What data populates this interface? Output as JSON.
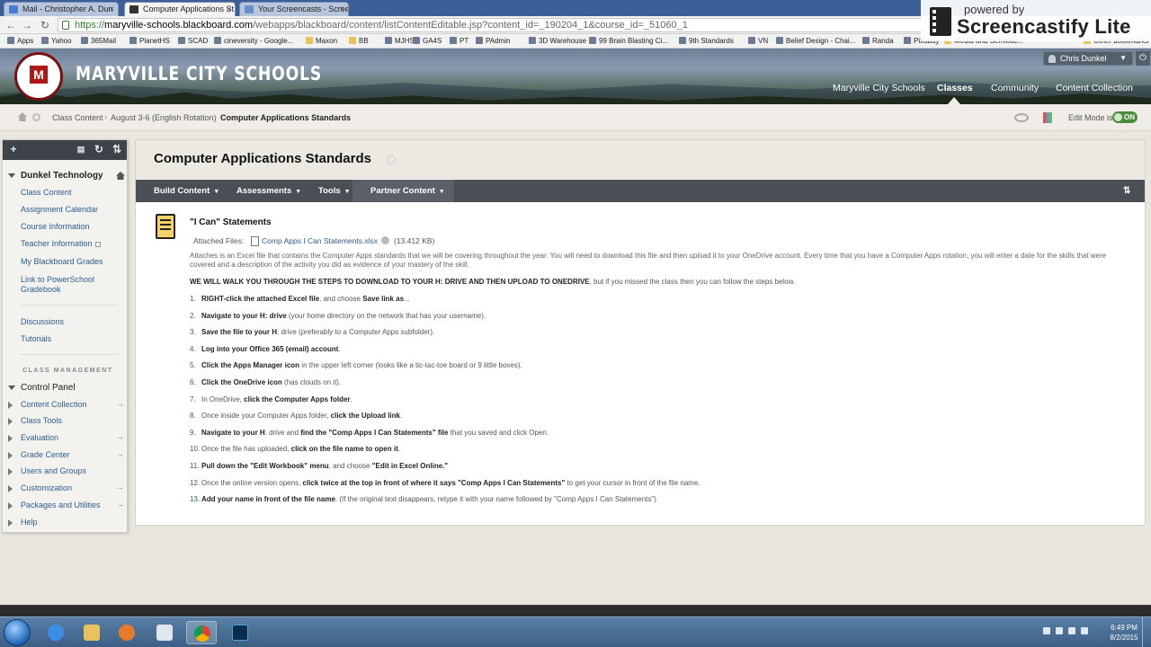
{
  "browser": {
    "tabs": [
      {
        "label": "Mail - Christopher A. Dun",
        "active": false
      },
      {
        "label": "Computer Applications St",
        "active": true
      },
      {
        "label": "Your Screencasts - Scree",
        "active": false
      }
    ],
    "url_scheme": "https://",
    "url_host": "maryville-schools.blackboard.com",
    "url_path": "/webapps/blackboard/content/listContentEditable.jsp?content_id=_190204_1&course_id=_51060_1",
    "bookmarks": [
      "Apps",
      "Yahoo",
      "365Mail",
      "PlanetHS",
      "SCAD",
      "cineversity - Google...",
      "Maxon",
      "BB",
      "MJHS",
      "GA4S",
      "PT",
      "PAdmin",
      "3D Warehouse",
      "99 Brain Blasting Ci...",
      "9th Standards",
      "VN",
      "Belief Design - Chai...",
      "Randa",
      "Pixabay",
      "Media and Semiotic...",
      "Other bookmarks"
    ]
  },
  "overlay": {
    "powered_by": "powered by",
    "brand": "Screencastify Lite"
  },
  "header": {
    "school_name": "MARYVILLE CITY SCHOOLS",
    "user_name": "Chris Dunkel",
    "nav": [
      {
        "label": "Maryville City Schools",
        "active": false
      },
      {
        "label": "Classes",
        "active": true
      },
      {
        "label": "Community",
        "active": false
      },
      {
        "label": "Content Collection",
        "active": false
      }
    ]
  },
  "breadcrumb": {
    "items": [
      "Class Content",
      "August 3-6 (English Rotation)",
      "Computer Applications Standards"
    ],
    "edit_mode_label": "Edit Mode is:",
    "edit_mode_state": "ON"
  },
  "sidebar": {
    "course_title": "Dunkel Technology",
    "links": [
      "Class Content",
      "Assignment Calendar",
      "Course Information",
      "Teacher Information",
      "My Blackboard Grades",
      "Link to PowerSchool Gradebook"
    ],
    "links2": [
      "Discussions",
      "Tutorials"
    ],
    "class_management_label": "CLASS MANAGEMENT",
    "control_panel": "Control Panel",
    "panel_items": [
      "Content Collection",
      "Class Tools",
      "Evaluation",
      "Grade Center",
      "Users and Groups",
      "Customization",
      "Packages and Utilities",
      "Help"
    ]
  },
  "main": {
    "page_title": "Computer Applications Standards",
    "actions": [
      "Build Content",
      "Assessments",
      "Tools",
      "Partner Content"
    ],
    "item_title": "\"I Can\" Statements",
    "attached_label": "Attached Files:",
    "attached_file": "Comp Apps I Can Statements.xlsx",
    "attached_size": "(13.412 KB)",
    "description": "Attaches is an Excel file that contains the Computer Apps standards that we will be covering throughout the year.  You will need to download this file and then upload it to your OneDrive account.  Every time that you have a Computer Apps rotation, you will enter a date for the skills that were covered and a description of the activity you did as evidence of your mastery of the skill.",
    "walk_bold": "WE WILL WALK YOU THROUGH THE STEPS TO DOWNLOAD TO YOUR H: DRIVE AND THEN UPLOAD TO ONEDRIVE",
    "walk_rest": ", but if you missed the class then you can follow the steps below.",
    "steps": [
      {
        "n": "1.",
        "bold": "RIGHT-click the attached Excel file",
        "rest": ", and choose ",
        "bold2": "Save link as",
        "rest2": "..."
      },
      {
        "n": "2.",
        "bold": "Navigate to your H: drive",
        "rest": " (your home directory on the network that has your username).",
        "bold2": "",
        "rest2": ""
      },
      {
        "n": "3.",
        "bold": "Save the file to your H",
        "rest": ": drive (preferably to a Computer Apps subfolder).",
        "bold2": "",
        "rest2": ""
      },
      {
        "n": "4.",
        "bold": "Log into your Office 365 (email) account",
        "rest": ".",
        "bold2": "",
        "rest2": ""
      },
      {
        "n": "5.",
        "bold": "Click the Apps Manager icon",
        "rest": " in the upper left corner (looks like a tic-tac-toe board or 9 little boxes).",
        "bold2": "",
        "rest2": ""
      },
      {
        "n": "6.",
        "bold": "Click the OneDrive icon",
        "rest": " (has clouds on it).",
        "bold2": "",
        "rest2": ""
      },
      {
        "n": "7.",
        "bold": "",
        "rest": "In OneDrive, ",
        "bold2": "click the Computer Apps folder",
        "rest2": "."
      },
      {
        "n": "8.",
        "bold": "",
        "rest": "Once inside your Computer Apps folder, ",
        "bold2": "click the Upload link",
        "rest2": "."
      },
      {
        "n": "9.",
        "bold": "Navigate to your H",
        "rest": ": drive and ",
        "bold2": "find the \"Comp Apps I Can Statements\" file",
        "rest2": " that you saved and click Open."
      },
      {
        "n": "10.",
        "bold": "",
        "rest": "Once the file has uploaded, ",
        "bold2": "click on the file name to open it",
        "rest2": "."
      },
      {
        "n": "11.",
        "bold": "Pull down the \"Edit Workbook\" menu",
        "rest": ", and choose ",
        "bold2": "\"Edit in Excel Online.\"",
        "rest2": ""
      },
      {
        "n": "12.",
        "bold": "",
        "rest": "Once the online version opens, ",
        "bold2": "click twice at the top in front of where it says \"Comp Apps I Can Statements\"",
        "rest2": " to get your cursor in front of the file name."
      },
      {
        "n": "13.",
        "bold": "Add your name in front of the file name",
        "rest": ".  (If the original text disappears, retype it with your name followed by \"Comp Apps I Can Statements\")",
        "bold2": "",
        "rest2": ""
      }
    ]
  },
  "taskbar": {
    "time": "6:49 PM",
    "date": "8/2/2015"
  },
  "colors": {
    "link": "#2b5d8f",
    "action_bar": "#4a4f56",
    "edit_on": "#4a8d3d"
  }
}
